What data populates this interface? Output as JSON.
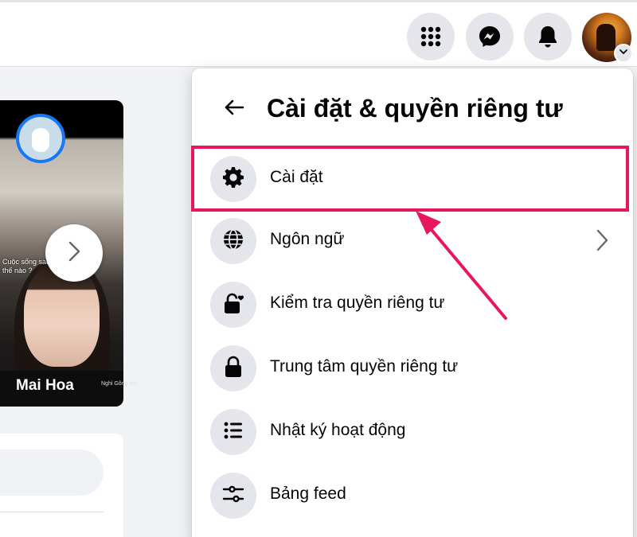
{
  "header": {
    "menu_icon": "grid-menu-icon",
    "messenger_icon": "messenger-icon",
    "notifications_icon": "bell-icon",
    "account_icon": "chevron-down-icon"
  },
  "story": {
    "name": "Mai Hoa",
    "caption": "Cuộc sống sau này như thế nào ?",
    "side_text": "Nghỉ Gông hỏi"
  },
  "settings_menu": {
    "title": "Cài đặt & quyền riêng tư",
    "items": [
      {
        "label": "Cài đặt",
        "icon": "gear-icon",
        "highlighted": true
      },
      {
        "label": "Ngôn ngữ",
        "icon": "globe-icon",
        "has_submenu": true
      },
      {
        "label": "Kiểm tra quyền riêng tư",
        "icon": "lock-heart-icon"
      },
      {
        "label": "Trung tâm quyền riêng tư",
        "icon": "lock-icon"
      },
      {
        "label": "Nhật ký hoạt động",
        "icon": "list-icon"
      },
      {
        "label": "Bảng feed",
        "icon": "sliders-icon"
      }
    ]
  },
  "colors": {
    "accent": "#1877f2",
    "highlight": "#e8175d",
    "icon_bg": "#e4e6eb"
  }
}
